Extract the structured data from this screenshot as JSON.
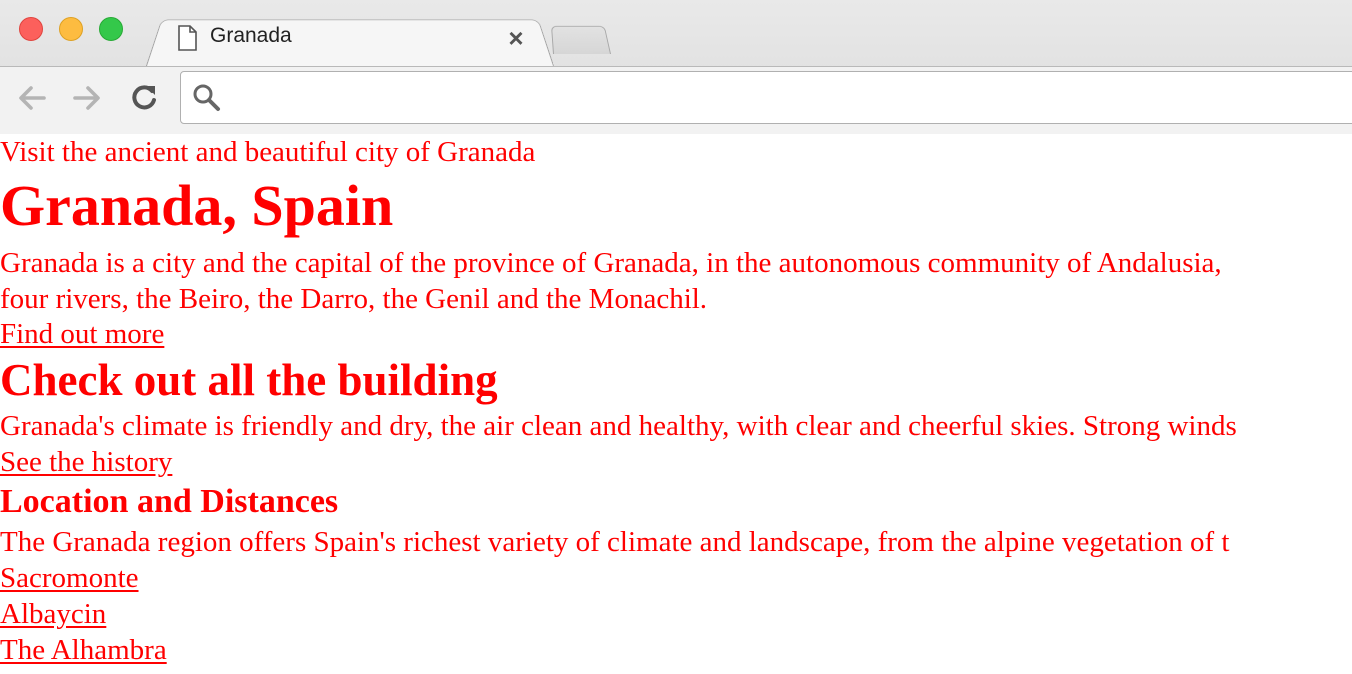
{
  "browser": {
    "tab_title": "Granada",
    "tab_close": "×",
    "address_value": "",
    "colors": {
      "close": "#fc605c",
      "minimize": "#fdbc40",
      "maximize": "#34c84a"
    },
    "icons": [
      "page-icon",
      "close-icon",
      "back-arrow-icon",
      "forward-arrow-icon",
      "reload-icon",
      "search-icon"
    ]
  },
  "page": {
    "text_color": "#ff0000",
    "tagline": "Visit the ancient and beautiful city of Granada",
    "heading": "Granada, Spain",
    "intro_line1": "Granada is a city and the capital of the province of Granada, in the autonomous community of Andalusia,",
    "intro_line2": "four rivers, the Beiro, the Darro, the Genil and the Monachil.",
    "find_out_more": "Find out more",
    "building_heading": "Check out all the building",
    "climate_text": "Granada's climate is friendly and dry, the air clean and healthy, with clear and cheerful skies. Strong winds",
    "see_history": "See the history",
    "location_heading": "Location and Distances",
    "region_text": "The Granada region offers Spain's richest variety of climate and landscape, from the alpine vegetation of t",
    "links": [
      "Sacromonte",
      "Albaycin",
      "The Alhambra"
    ]
  }
}
